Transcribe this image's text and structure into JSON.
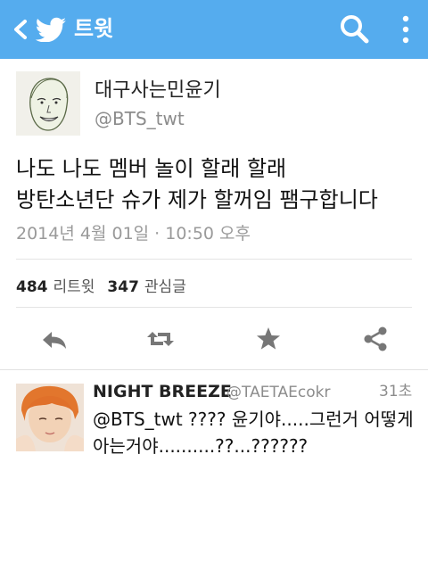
{
  "header": {
    "title": "트윗",
    "back_icon": "chevron-left-icon",
    "logo_icon": "twitter-bird-icon",
    "search_icon": "search-icon",
    "more_icon": "vertical-dots-icon",
    "color": "#55acee"
  },
  "tweet": {
    "display_name": "대구사는민윤기",
    "handle": "@BTS_twt",
    "text_lines": [
      "나도 나도 멤버 놀이 할래 할래",
      "방탄소년단 슈가 제가 할꺼임 팸구합니다"
    ],
    "timestamp": "2014년 4월 01일 · 10:50 오후",
    "retweet_count": "484",
    "retweet_label": "리트윗",
    "favorite_count": "347",
    "favorite_label": "관심글"
  },
  "actions": [
    {
      "icon": "reply-icon"
    },
    {
      "icon": "retweet-icon"
    },
    {
      "icon": "star-icon"
    },
    {
      "icon": "share-icon"
    }
  ],
  "reply": {
    "display_name": "NIGHT BREEZE",
    "handle": "@TAETAEcokr",
    "time": "31초",
    "text_lines": [
      "@BTS_twt ???? 윤기야.....그런거 어떻게",
      "아는거야..........??...??????"
    ]
  }
}
